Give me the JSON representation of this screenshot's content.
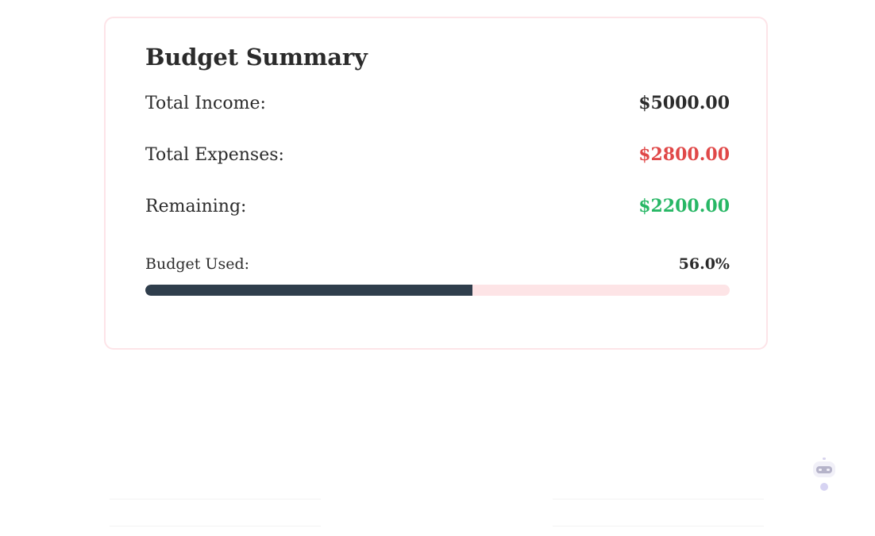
{
  "summary": {
    "title": "Budget Summary",
    "rows": [
      {
        "label": "Total Income:",
        "value": "$5000.00",
        "color": "#2b2b2b"
      },
      {
        "label": "Total Expenses:",
        "value": "$2800.00",
        "color": "#e04848"
      },
      {
        "label": "Remaining:",
        "value": "$2200.00",
        "color": "#27b765"
      }
    ],
    "budget_used": {
      "label": "Budget Used:",
      "percent_text": "56.0%",
      "percent": 56.0,
      "fill_color": "#2f3e4c",
      "track_color": "#fde4e6"
    }
  },
  "assistant": {
    "icon": "robot-icon"
  }
}
